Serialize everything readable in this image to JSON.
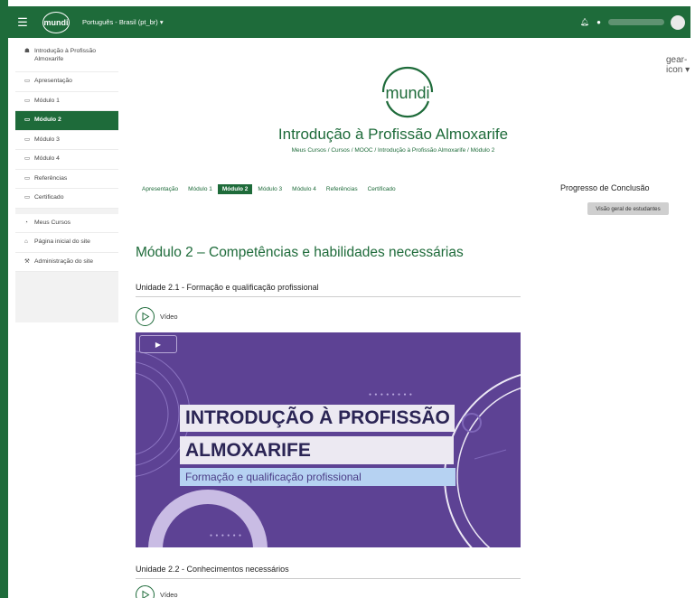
{
  "topbar": {
    "menu_icon": "hamburger-icon",
    "logo_text": "mundi",
    "language": "Português - Brasil (pt_br) ▾",
    "icons": [
      "bell-icon",
      "chat-icon",
      "avatar"
    ]
  },
  "sidebar": {
    "course_items": [
      {
        "icon": "graduation-cap-icon",
        "label": "Introdução à Profissão Almoxarife"
      },
      {
        "icon": "folder-icon",
        "label": "Apresentação"
      },
      {
        "icon": "folder-icon",
        "label": "Módulo 1"
      },
      {
        "icon": "folder-icon",
        "label": "Módulo 2"
      },
      {
        "icon": "folder-icon",
        "label": "Módulo 3"
      },
      {
        "icon": "folder-icon",
        "label": "Módulo 4"
      },
      {
        "icon": "folder-icon",
        "label": "Referências"
      },
      {
        "icon": "folder-icon",
        "label": "Certificado"
      }
    ],
    "site_items": [
      {
        "icon": "dashboard-icon",
        "label": "Meus Cursos"
      },
      {
        "icon": "home-icon",
        "label": "Página inicial do site"
      },
      {
        "icon": "wrench-icon",
        "label": "Administração do site"
      }
    ]
  },
  "header": {
    "brand_text": "mundi",
    "course_title": "Introdução à Profissão Almoxarife",
    "breadcrumb": "Meus Cursos / Cursos / MOOC / Introdução à Profissão Almoxarife / Módulo 2",
    "settings_icon": "gear-icon ▾"
  },
  "module_nav": [
    "Apresentação",
    "Módulo 1",
    "Módulo 2",
    "Módulo 3",
    "Módulo 4",
    "Referências",
    "Certificado"
  ],
  "progress": {
    "title": "Progresso de Conclusão",
    "button": "Visão geral de estudantes"
  },
  "content": {
    "section_title": "Módulo 2 – Competências e habilidades necessárias",
    "units": [
      {
        "title": "Unidade 2.1 - Formação e qualificação profissional",
        "video_label": "Vídeo"
      },
      {
        "title": "Unidade 2.2 - Conhecimentos necessários",
        "video_label": "Vídeo"
      }
    ],
    "thumbnail": {
      "line1": "INTRODUÇÃO À PROFISSÃO",
      "line2": "ALMOXARIFE",
      "line3": "Formação e qualificação profissional",
      "play_icon": "▶"
    }
  },
  "colors": {
    "brand": "#1e6b3a",
    "thumb_bg": "#5d4294"
  }
}
